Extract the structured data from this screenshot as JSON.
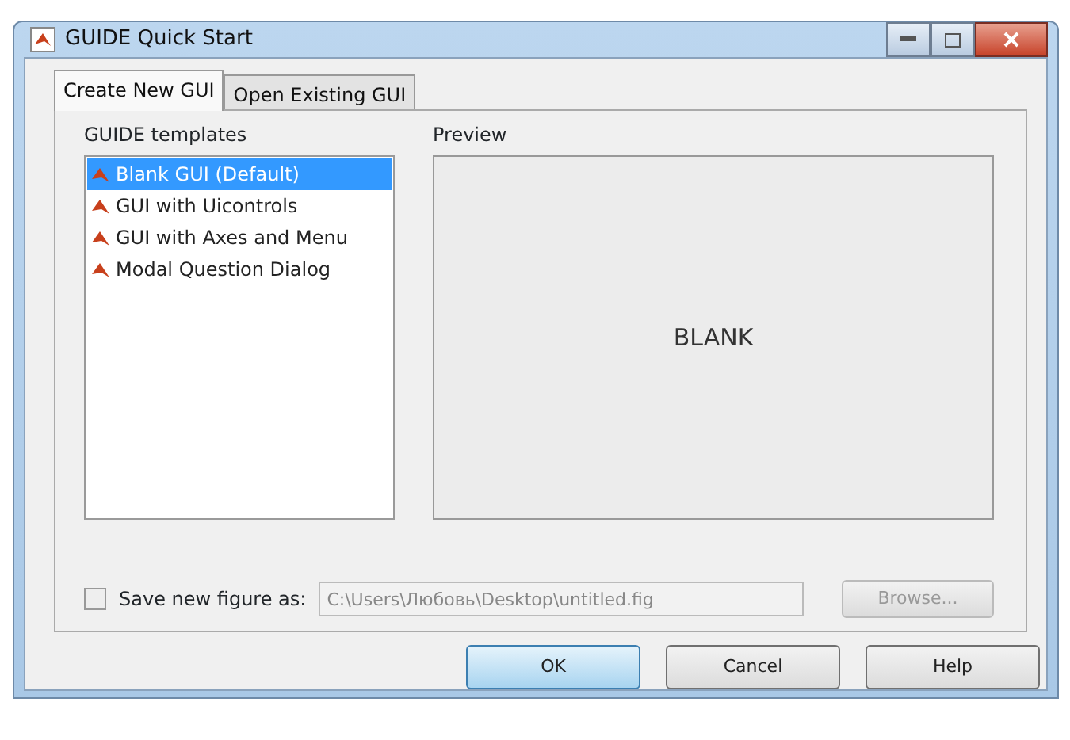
{
  "window": {
    "title": "GUIDE Quick Start"
  },
  "tabs": [
    {
      "label": "Create New GUI",
      "selected": true
    },
    {
      "label": "Open Existing GUI",
      "selected": false
    }
  ],
  "templates": {
    "label": "GUIDE templates",
    "items": [
      {
        "label": "Blank GUI (Default)",
        "selected": true
      },
      {
        "label": "GUI with Uicontrols",
        "selected": false
      },
      {
        "label": "GUI with Axes and Menu",
        "selected": false
      },
      {
        "label": "Modal Question Dialog",
        "selected": false
      }
    ]
  },
  "preview": {
    "label": "Preview",
    "text": "BLANK"
  },
  "save": {
    "label": "Save new figure as:",
    "checked": false,
    "value": "C:\\Users\\Любовь\\Desktop\\untitled.fig",
    "browse": "Browse..."
  },
  "buttons": [
    {
      "label": "OK",
      "default": true
    },
    {
      "label": "Cancel",
      "default": false
    },
    {
      "label": "Help",
      "default": false
    }
  ]
}
